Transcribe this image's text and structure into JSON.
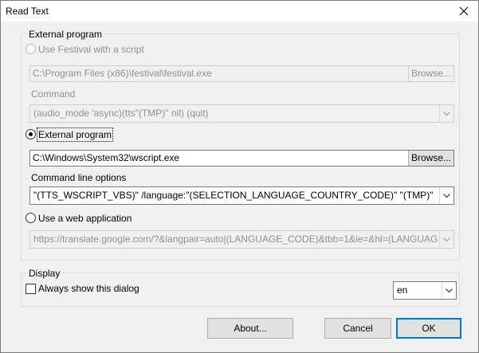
{
  "window": {
    "title": "Read Text"
  },
  "external_group": {
    "caption": "External program",
    "festival_radio_label": "Use Festival with a script",
    "festival_path": "C:\\Program Files (x86)\\festival\\festival.exe",
    "festival_browse_label": "Browse...",
    "command_label": "Command",
    "command_value": "(audio_mode 'async)(tts\"(TMP)\" nil) (quit)",
    "external_radio_label": "External program",
    "external_path": "C:\\Windows\\System32\\wscript.exe",
    "external_browse_label": "Browse...",
    "cmdline_label": "Command line options",
    "cmdline_value": "\"(TTS_WSCRIPT_VBS)\" /language:\"(SELECTION_LANGUAGE_COUNTRY_CODE)\" \"(TMP)\"",
    "web_radio_label": "Use a web application",
    "web_url": "https://translate.google.com/?&langpair=auto|(LANGUAGE_CODE)&tbb=1&ie=&hl=(LANGUAG"
  },
  "display_group": {
    "caption": "Display",
    "always_show_label": "Always show this dialog",
    "language_value": "en"
  },
  "buttons": {
    "about": "About...",
    "cancel": "Cancel",
    "ok": "OK"
  }
}
